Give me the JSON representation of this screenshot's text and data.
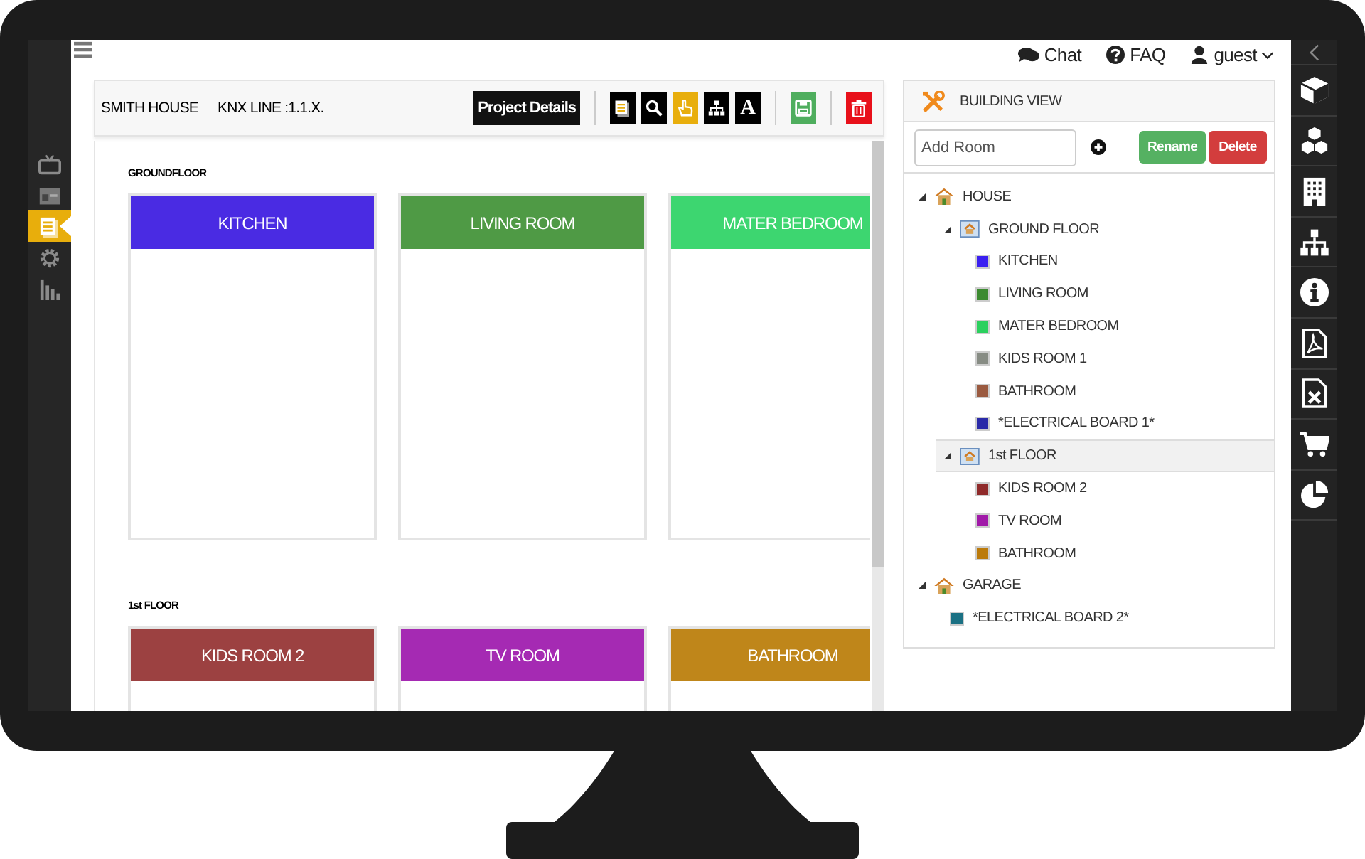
{
  "top_bar": {
    "menu": {
      "kind": "menu"
    },
    "links": [
      {
        "label": "Chat",
        "kind": "chat"
      },
      {
        "label": "FAQ",
        "kind": "faq"
      },
      {
        "label": "guest",
        "kind": "user"
      }
    ]
  },
  "sidebar_left": {
    "items": [
      {
        "kind": "tv",
        "selected": false
      },
      {
        "kind": "calendar",
        "selected": false
      },
      {
        "kind": "doc",
        "selected": true
      },
      {
        "kind": "gear",
        "selected": false
      },
      {
        "kind": "bars",
        "selected": false
      }
    ]
  },
  "project": {
    "name": "SMITH HOUSE",
    "line": "KNX LINE :1.1.X.",
    "details_button": "Project Details",
    "tools": [
      {
        "kind": "doc",
        "color": "#000000"
      },
      {
        "kind": "search",
        "color": "#000000"
      },
      {
        "kind": "hand",
        "color": "#e8ae0c"
      },
      {
        "kind": "sitemap",
        "color": "#000000"
      },
      {
        "kind": "text",
        "label": "A",
        "color": "#000000"
      },
      {
        "kind": "save",
        "color": "#4fae5e"
      },
      {
        "kind": "trash",
        "color": "#e8101a"
      }
    ]
  },
  "floors": [
    {
      "label": "GROUNDFLOOR",
      "rooms": [
        {
          "name": "KITCHEN",
          "color": "#4a2be3"
        },
        {
          "name": "LIVING ROOM",
          "color": "#4f9a45"
        },
        {
          "name": "MATER BEDROOM",
          "color": "#3dd670"
        }
      ]
    },
    {
      "label": "1st FLOOR",
      "rooms": [
        {
          "name": "KIDS ROOM 2",
          "color": "#9c4141"
        },
        {
          "name": "TV ROOM",
          "color": "#a52ab3"
        },
        {
          "name": "BATHROOM",
          "color": "#bf861a"
        }
      ]
    }
  ],
  "building_view": {
    "title": "BUILDING VIEW",
    "add_room": {
      "placeholder": "Add Room"
    },
    "buttons": [
      {
        "label": "Rename",
        "kind": "rename"
      },
      {
        "label": "Delete",
        "kind": "delete"
      }
    ],
    "tree": [
      {
        "label": "HOUSE",
        "kind": "house",
        "expanded": true,
        "selected": false,
        "children": [
          {
            "label": "GROUND FLOOR",
            "kind": "floor",
            "expanded": true,
            "selected": false,
            "children": [
              {
                "label": "KITCHEN",
                "kind": "room",
                "color": "#3a1ff0",
                "selected": false
              },
              {
                "label": "LIVING ROOM",
                "kind": "room",
                "color": "#3c8a30",
                "selected": false
              },
              {
                "label": "MATER BEDROOM",
                "kind": "room",
                "color": "#2bd05e",
                "selected": false
              },
              {
                "label": "KIDS ROOM 1",
                "kind": "room",
                "color": "#878c84",
                "selected": false
              },
              {
                "label": "BATHROOM",
                "kind": "room",
                "color": "#9a5a40",
                "selected": false
              },
              {
                "label": "*ELECTRICAL BOARD 1*",
                "kind": "room",
                "color": "#2a2aa8",
                "selected": false
              }
            ]
          },
          {
            "label": "1st FLOOR",
            "kind": "floor",
            "expanded": true,
            "selected": true,
            "children": [
              {
                "label": "KIDS ROOM 2",
                "kind": "room",
                "color": "#8f2a2a",
                "selected": false
              },
              {
                "label": "TV ROOM",
                "kind": "room",
                "color": "#a019a8",
                "selected": false
              },
              {
                "label": "BATHROOM",
                "kind": "room",
                "color": "#bb7a0a",
                "selected": false
              }
            ]
          }
        ]
      },
      {
        "label": "GARAGE",
        "kind": "house",
        "expanded": true,
        "selected": false,
        "children": [
          {
            "label": "*ELECTRICAL BOARD 2*",
            "kind": "room",
            "color": "#1b7184",
            "selected": false
          }
        ]
      }
    ]
  },
  "sidebar_right": {
    "items": [
      {
        "kind": "collapse"
      },
      {
        "kind": "cube"
      },
      {
        "kind": "cubes"
      },
      {
        "kind": "building"
      },
      {
        "kind": "sitemap"
      },
      {
        "kind": "info"
      },
      {
        "kind": "pdf"
      },
      {
        "kind": "excel"
      },
      {
        "kind": "cart"
      },
      {
        "kind": "pie"
      }
    ]
  }
}
